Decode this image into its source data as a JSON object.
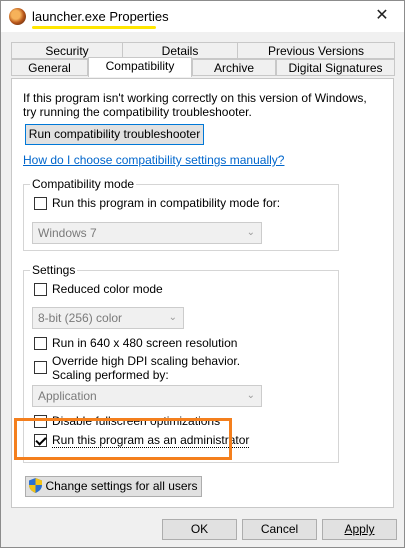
{
  "window": {
    "title": "launcher.exe Properties",
    "close_glyph": "✕"
  },
  "tabs_back": [
    "Security",
    "Details",
    "Previous Versions"
  ],
  "tabs_front": [
    "General",
    "Compatibility",
    "Archive",
    "Digital Signatures"
  ],
  "intro_text": [
    "If this program isn't working correctly on this version of Windows,",
    "try running the compatibility troubleshooter."
  ],
  "troubleshooter_button": "Run compatibility troubleshooter",
  "manual_link": "How do I choose compatibility settings manually?",
  "compat_mode": {
    "group_title": "Compatibility mode",
    "checkbox_label": "Run this program in compatibility mode for:",
    "checked": false,
    "os_select": "Windows 7"
  },
  "settings": {
    "group_title": "Settings",
    "reduced_color_label": "Reduced color mode",
    "color_select": "8-bit (256) color",
    "res_640_label": "Run in 640 x 480 screen resolution",
    "dpi_label_1": "Override high DPI scaling behavior.",
    "dpi_label_2": "Scaling performed by:",
    "dpi_select": "Application",
    "fullscreen_label": "Disable fullscreen optimizations",
    "admin_label": "Run this program as an administrator",
    "admin_checked": true
  },
  "change_all_button": "Change settings for all users",
  "footer": {
    "ok": "OK",
    "cancel": "Cancel",
    "apply": "Apply"
  },
  "colors": {
    "highlight": "#f47f1d",
    "title_underline": "#ffe600",
    "link": "#0066cc"
  },
  "icons": {
    "app": "launcher-app-icon",
    "shield": "uac-shield-icon",
    "dropdown": "chevron-down-icon"
  }
}
